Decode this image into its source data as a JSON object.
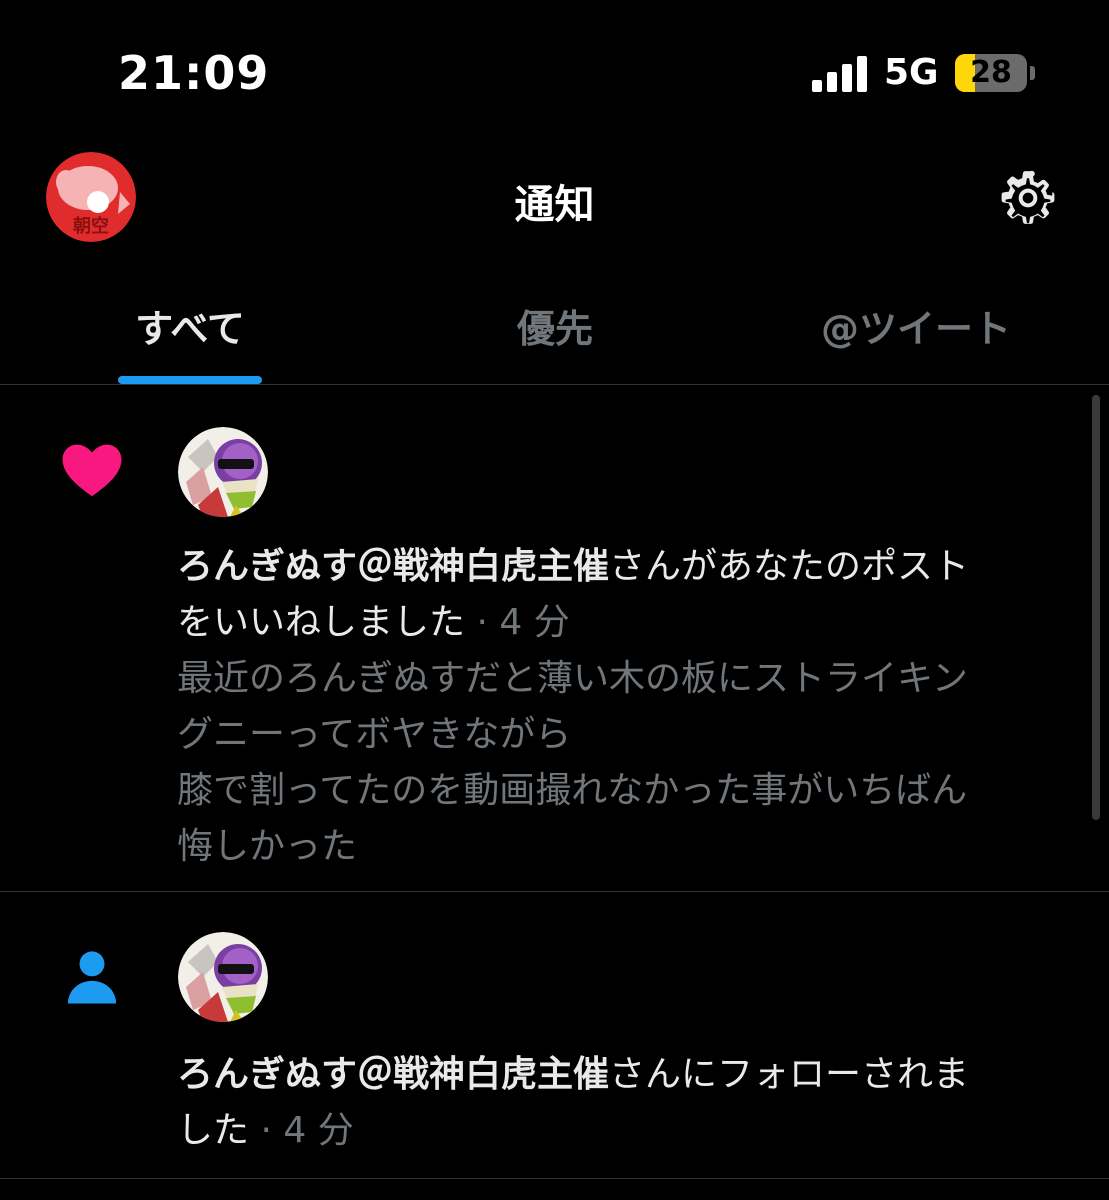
{
  "status_bar": {
    "time": "21:09",
    "network": "5G",
    "battery_level": "28",
    "battery_fraction": 0.28
  },
  "header": {
    "title": "通知",
    "settings_icon": "gear-icon",
    "avatar_text": "朝空"
  },
  "tabs": [
    {
      "label": "すべて",
      "active": true
    },
    {
      "label": "優先",
      "active": false
    },
    {
      "label": "@ツイート",
      "active": false
    }
  ],
  "notifications": [
    {
      "type_icon": "heart-icon",
      "icon_color": "#f91880",
      "user": "ろんぎぬす＠戦神白虎主催",
      "action_line1": "さんがあなたのポスト",
      "action_line2": "をいいねしました",
      "time": " · 4 分",
      "post_lines": [
        "最近のろんぎぬすだと薄い木の板にストライキン",
        "グニーってボヤきながら",
        "膝で割ってたのを動画撮れなかった事がいちばん",
        "悔しかった"
      ]
    },
    {
      "type_icon": "person-icon",
      "icon_color": "#1d9bf0",
      "user": "ろんぎぬす＠戦神白虎主催",
      "action_line1": "さんにフォローされま",
      "action_line2": "した",
      "time": " · 4 分"
    }
  ],
  "colors": {
    "background": "#000000",
    "accent": "#1d9bf0",
    "like": "#f91880",
    "secondary_text": "#71767b",
    "divider": "#2f3336"
  }
}
